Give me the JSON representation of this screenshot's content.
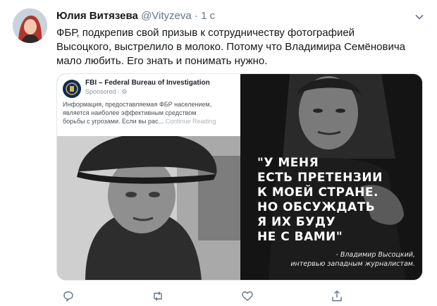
{
  "author": {
    "name": "Юлия Витязева",
    "handle": "@Vityzeva",
    "separator": "·",
    "time": "1 с"
  },
  "tweet": {
    "lines": [
      "ФБР, подкрепив свой призыв к сотрудничеству фотографией",
      "Высоцкого, выстрелило в молоко. Потому что Владимира Семёновича",
      "мало любить. Его знать и понимать нужно."
    ]
  },
  "fb_ad": {
    "page_name": "FBI – Federal Bureau of Investigation",
    "sponsored": "Sponsored · ⚙",
    "body_lines": [
      "Информация, предоставляемая ФБР населением,",
      "является наиболее эффективным средством",
      "борьбы с угрозами. Если вы рас..."
    ],
    "continue": "Continue Reading"
  },
  "quote": {
    "lines": [
      "\"У МЕНЯ",
      "ЕСТЬ ПРЕТЕНЗИИ",
      "К МОЕЙ СТРАНЕ.",
      "НО ОБСУЖДАТЬ",
      "Я ИХ БУДУ",
      "НЕ С ВАМИ\""
    ],
    "attribution_lines": [
      "- Владимир Высоцкий,",
      "интервью западным журналистам."
    ]
  },
  "icons": [
    "chevron-down-icon",
    "reply-icon",
    "retweet-icon",
    "like-icon",
    "share-icon"
  ],
  "colors": {
    "text": "#14171a",
    "secondary": "#657786",
    "accent": "#1da1f2"
  }
}
